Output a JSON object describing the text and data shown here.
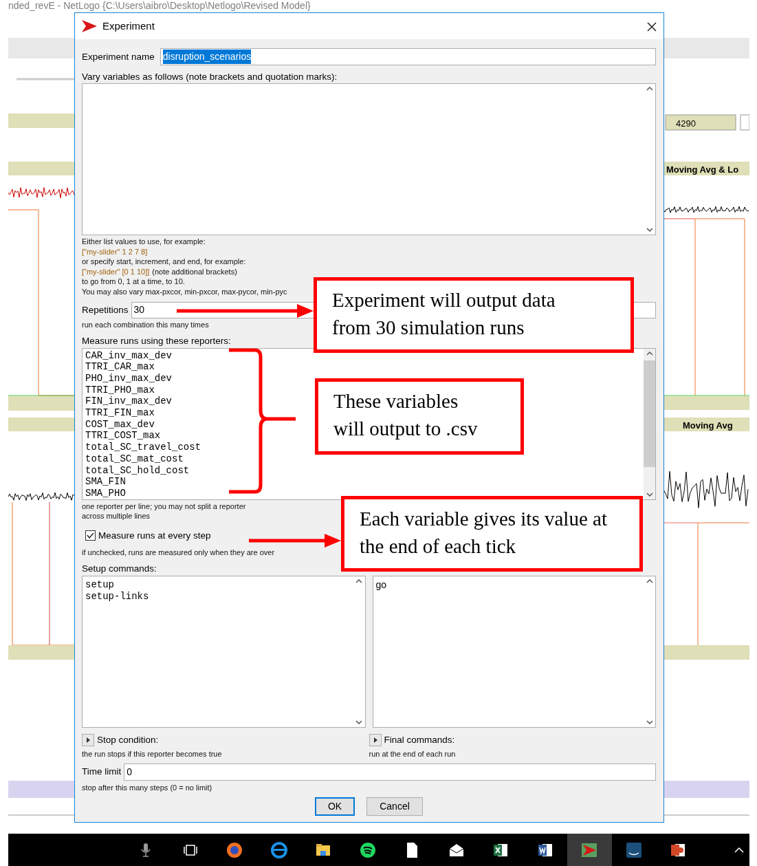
{
  "background_window": {
    "title": "nded_revE - NetLogo {C:\\Users\\aibro\\Desktop\\Netlogo\\Revised Model}",
    "monitor_value": "4290",
    "plot_titles": [
      "Moving Avg & Lo",
      "Moving Avg"
    ]
  },
  "dialog": {
    "title": "Experiment",
    "experiment_name": {
      "label": "Experiment name",
      "value": "disruption_scenarios",
      "text_selected": true
    },
    "vary_variables": {
      "label": "Vary variables as follows (note brackets and quotation marks):",
      "help_lines": [
        [
          {
            "text": "Either list values to use, for example:",
            "code": false
          }
        ],
        [
          {
            "text": "[\"my-slider\" 1 2 7 8]",
            "code": true
          }
        ],
        [
          {
            "text": "or specify start, increment, and end, for example:",
            "code": false
          }
        ],
        [
          {
            "text": "[\"my-slider\" [0 1 10]]",
            "code": true
          },
          {
            "text": "(note additional brackets)",
            "code": false
          }
        ],
        [
          {
            "text": "to go from 0, 1 at a time, to 10.",
            "code": false
          }
        ],
        [
          {
            "text": "You may also vary max-pxcor, min-pxcor, max-pycor, min-pyc",
            "code": false
          }
        ]
      ]
    },
    "repetitions": {
      "label": "Repetitions",
      "value": "30",
      "help": "run each combination this many times"
    },
    "reporters": {
      "label": "Measure runs using these reporters:",
      "lines": [
        "CAR_inv_max_dev",
        "TTRI_CAR_max",
        "PHO_inv_max_dev",
        "TTRI_PHO_max",
        "FIN_inv_max_dev",
        "TTRI_FIN_max",
        "COST_max_dev",
        "TTRI_COST_max",
        "total_SC_travel_cost",
        "total_SC_mat_cost",
        "total_SC_hold_cost",
        "SMA_FIN",
        "SMA_PHO"
      ],
      "help": [
        "one reporter per line; you may not split a reporter",
        "across multiple lines"
      ]
    },
    "measure_every_step": {
      "label": "Measure runs at every step",
      "checked": true,
      "help": "if unchecked, runs are measured only when they are over"
    },
    "setup_commands": {
      "label": "Setup commands:",
      "lines": [
        "setup",
        "setup-links"
      ]
    },
    "go_commands": {
      "lines": [
        "go"
      ]
    },
    "stop_condition": {
      "label": "Stop condition:",
      "help": "the run stops if this reporter becomes true",
      "expanded": false
    },
    "final_commands": {
      "label": "Final commands:",
      "help": "run at the end of each run",
      "expanded": false
    },
    "time_limit": {
      "label": "Time limit",
      "value": "0",
      "help": "stop after this many steps (0 = no limit)"
    },
    "buttons": [
      {
        "label": "OK",
        "default": true
      },
      {
        "label": "Cancel",
        "default": false
      }
    ]
  },
  "annotations": [
    {
      "kind": "arrow",
      "text": "Experiment will output data from 30 simulation runs"
    },
    {
      "kind": "brace",
      "text": "These variables will output to .csv"
    },
    {
      "kind": "arrow",
      "text": "Each variable gives its value at the end of each tick"
    }
  ],
  "taskbar": {
    "icons": [
      {
        "kind": "microphone",
        "selected": false
      },
      {
        "kind": "task-view",
        "selected": false
      },
      {
        "kind": "browser-orange",
        "selected": false
      },
      {
        "kind": "browser-blue",
        "selected": false
      },
      {
        "kind": "folder",
        "selected": false
      },
      {
        "kind": "music-green",
        "selected": false
      },
      {
        "kind": "document",
        "selected": false
      },
      {
        "kind": "mail",
        "selected": false
      },
      {
        "kind": "spreadsheet",
        "selected": false
      },
      {
        "kind": "word-processor",
        "selected": false
      },
      {
        "kind": "arrow-app",
        "selected": true
      },
      {
        "kind": "music-box",
        "selected": false
      },
      {
        "kind": "slides",
        "selected": false
      }
    ]
  }
}
